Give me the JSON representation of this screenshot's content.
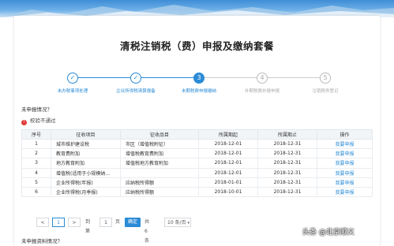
{
  "page_title": "清税注销税（费）申报及缴纳套餐",
  "steps": [
    {
      "num": "✓",
      "label": "未办税事项处理",
      "state": "done"
    },
    {
      "num": "✓",
      "label": "企业所得税清算报备",
      "state": "done"
    },
    {
      "num": "3",
      "label": "未期税费申报缴纳",
      "state": "active"
    },
    {
      "num": "4",
      "label": "补期税费补报申报",
      "state": "todo"
    },
    {
      "num": "5",
      "label": "注销税务登记",
      "state": "todo"
    }
  ],
  "section1_title": "未申报情况？",
  "warning_text": "校验不通过",
  "warning_icon": "alert-icon",
  "table": {
    "headers": [
      "序号",
      "征收项目",
      "征收品目",
      "所属期起",
      "所属期止",
      "操作"
    ],
    "rows": [
      [
        "1",
        "城市维护建设税",
        "市区（增值税附征）",
        "2018-12-01",
        "2018-12-31",
        "我要申报"
      ],
      [
        "2",
        "教育费附加",
        "增值税教育费附加",
        "2018-12-01",
        "2018-12-31",
        "我要申报"
      ],
      [
        "3",
        "地方教育附加",
        "增值税地方教育附加",
        "2018-12-01",
        "2018-12-31",
        "我要申报"
      ],
      [
        "4",
        "增值税(适用于小规模纳...",
        "",
        "2018-12-01",
        "2018-12-31",
        "我要申报"
      ],
      [
        "5",
        "企业所得税(年报)",
        "应纳税所得额",
        "2018-01-01",
        "2018-12-31",
        "我要申报"
      ],
      [
        "6",
        "企业所得税(月季报)",
        "应纳税所得额",
        "2018-10-01",
        "2018-12-31",
        "我要申报"
      ]
    ]
  },
  "pager": {
    "prev": "<",
    "page": "1",
    "next": ">",
    "goto_label": "到第",
    "goto_value": "1",
    "page_unit": "页",
    "go_label": "确定",
    "total": "共 6 条",
    "page_size": "10 条/页",
    "dropdown_icon": "chevron-down-icon"
  },
  "section2_title": "未申报资料情况？",
  "watermark": "头条 @北京顺义",
  "colors": {
    "accent": "#2a8bd6",
    "warning": "#e23a3a",
    "banner": "#3f8ed6"
  }
}
